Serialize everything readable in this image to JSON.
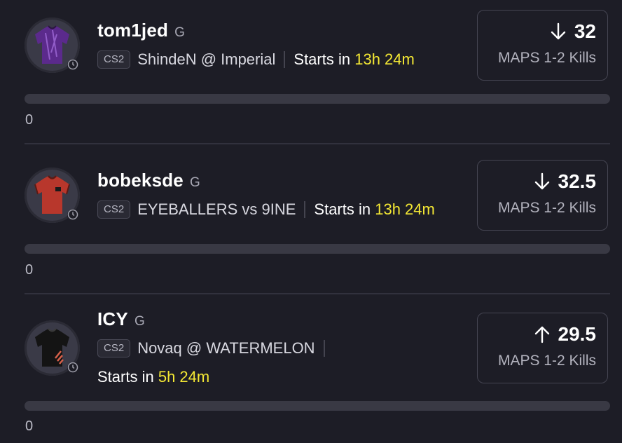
{
  "colors": {
    "background": "#1d1d26",
    "highlight_time": "#f4e834",
    "progress_track": "#393944"
  },
  "props": [
    {
      "player": "tom1jed",
      "position": "G",
      "game": "CS2",
      "matchup": "ShindeN @ Imperial",
      "starts_prefix": "Starts in",
      "starts_time": "13h 24m",
      "direction": "down",
      "direction_icon": "arrow-down-icon",
      "line": "32",
      "stat": "MAPS 1-2 Kills",
      "progress_fraction": 0,
      "count": "0",
      "jersey_color": "#5b2a8c"
    },
    {
      "player": "bobeksde",
      "position": "G",
      "game": "CS2",
      "matchup": "EYEBALLERS vs 9INE",
      "starts_prefix": "Starts in",
      "starts_time": "13h 24m",
      "direction": "down",
      "direction_icon": "arrow-down-icon",
      "line": "32.5",
      "stat": "MAPS 1-2 Kills",
      "progress_fraction": 0,
      "count": "0",
      "jersey_color": "#b8372c"
    },
    {
      "player": "ICY",
      "position": "G",
      "game": "CS2",
      "matchup": "Novaq @ WATERMELON",
      "starts_prefix": "Starts in",
      "starts_time": "5h 24m",
      "direction": "up",
      "direction_icon": "arrow-up-icon",
      "line": "29.5",
      "stat": "MAPS 1-2 Kills",
      "progress_fraction": 0,
      "count": "0",
      "jersey_color": "#141414"
    }
  ]
}
